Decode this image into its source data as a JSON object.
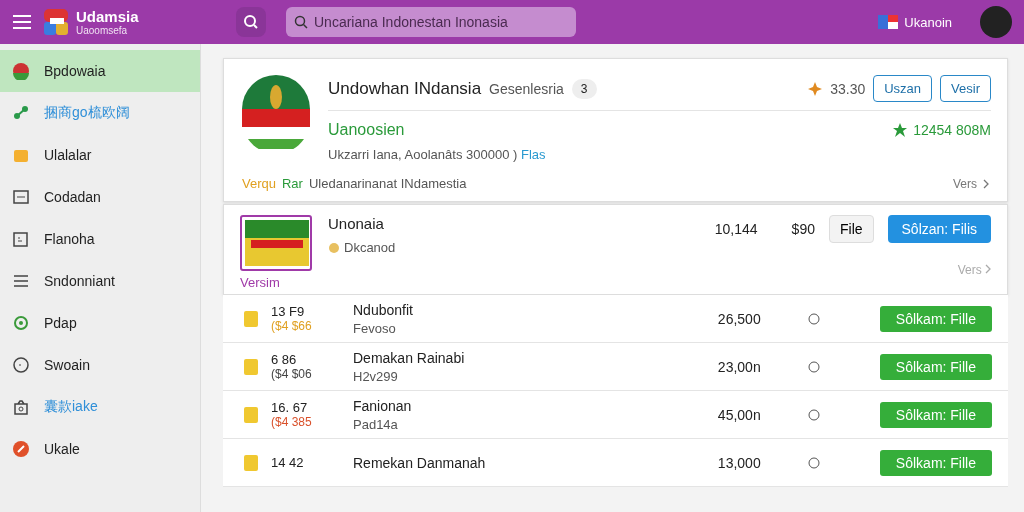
{
  "topbar": {
    "app_name": "Udamsia",
    "app_subtitle": "Uaoomsefa",
    "search_placeholder": "Uncariana Indonestan Inonasia",
    "language": "Ukanoin"
  },
  "sidebar": {
    "items": [
      {
        "label": "Bpdowaia",
        "selected": true,
        "color": "#1f1f1f"
      },
      {
        "label": "捆商go梳欧阔",
        "selected": false,
        "color": "#2f8fd8"
      },
      {
        "label": "Ulalalar",
        "selected": false,
        "color": "#1f1f1f"
      },
      {
        "label": "Codadan",
        "selected": false,
        "color": "#1f1f1f"
      },
      {
        "label": "Flanoha",
        "selected": false,
        "color": "#1f1f1f"
      },
      {
        "label": "Sndonniant",
        "selected": false,
        "color": "#1f1f1f"
      },
      {
        "label": "Pdap",
        "selected": false,
        "color": "#1f1f1f"
      },
      {
        "label": "Swoain",
        "selected": false,
        "color": "#1f1f1f"
      },
      {
        "label": "囊款iake",
        "selected": false,
        "color": "#2f8fd8"
      },
      {
        "label": "Ukale",
        "selected": false,
        "color": "#1f1f1f"
      }
    ]
  },
  "featured": {
    "title": "Undowhan INdansia",
    "subtitle": "Gesenlesria",
    "badge": "3",
    "rating": "33.30",
    "buttons": [
      "Uszan",
      "Vesir"
    ],
    "status": "Uanoosien",
    "info": "Ukzarri Iana, Aoolanâts 300000 )",
    "info_link": "Flas",
    "stat": "12454 808M",
    "footer_label_1": "Verqu",
    "footer_label_2": "Rar",
    "footer_text": "Uledanarinanat INdamestia",
    "more": "Vers"
  },
  "item": {
    "name": "Unonaia",
    "status": "Dkcanod",
    "caption": "Versim",
    "count": "10,144",
    "price": "$90",
    "file_button": "File",
    "primary_button": "Sôlzan: Filis",
    "more": "Vers"
  },
  "rows": [
    {
      "time": "13 F9",
      "code": "($4 $66",
      "color": "#e0a020",
      "name": "Ndubonfit",
      "detail": "Fevoso",
      "amount": "26,500",
      "action": "Sôlkam: Fille"
    },
    {
      "time": "6 86",
      "code": "($4 $06",
      "color": "#444444",
      "name": "Demakan Rainabi",
      "detail": "H2v299",
      "amount": "23,00n",
      "action": "Sôlkam: Fille"
    },
    {
      "time": "16. 67",
      "code": "($4 385",
      "color": "#d9502a",
      "name": "Fanionan",
      "detail": "Pad14a",
      "amount": "45,00n",
      "action": "Sôlkam: Fille"
    },
    {
      "time": "14 42",
      "name": "Remekan Danmanah",
      "amount": "13,000",
      "action": "Sôlkam: Fille"
    }
  ]
}
